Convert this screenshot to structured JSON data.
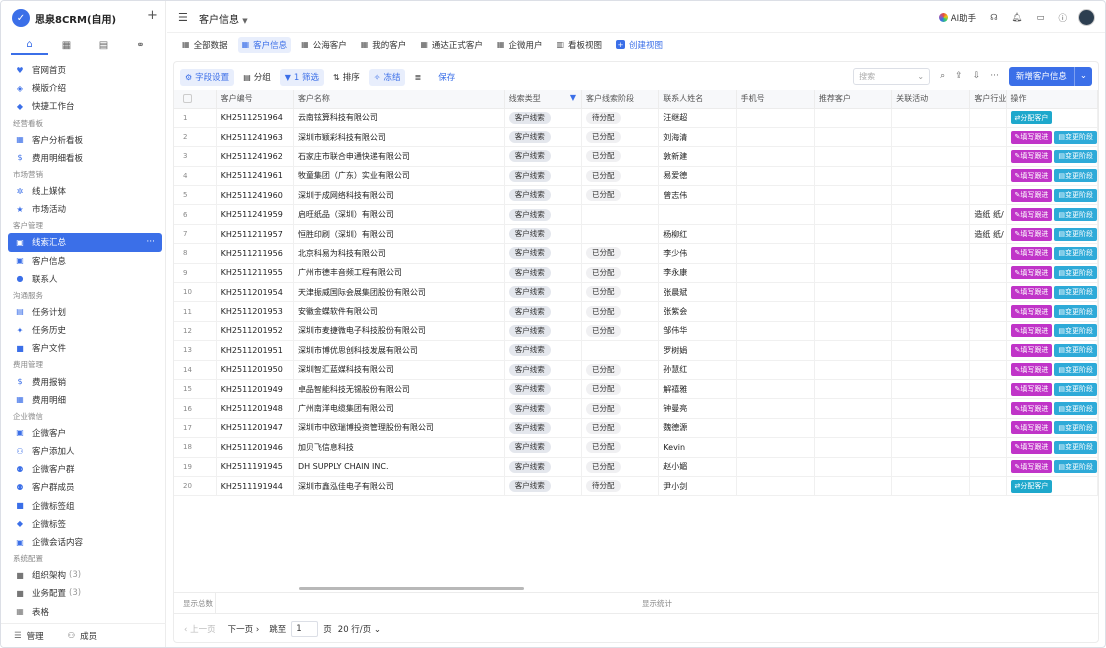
{
  "app": {
    "name": "思泉8CRM(自用)",
    "logo_letter": "✓"
  },
  "sidebar": {
    "tabs": [
      {
        "icon": "home-icon"
      },
      {
        "icon": "grid-icon"
      },
      {
        "icon": "document-icon"
      },
      {
        "icon": "flow-icon"
      }
    ],
    "items": [
      {
        "type": "item",
        "label": "官网首页",
        "icon": "heart-icon",
        "glyph": "♥"
      },
      {
        "type": "item",
        "label": "模版介绍",
        "icon": "palette-icon",
        "glyph": "◈"
      },
      {
        "type": "item",
        "label": "快捷工作台",
        "icon": "diamond-icon",
        "glyph": "◆"
      },
      {
        "type": "group",
        "label": "经营看板"
      },
      {
        "type": "item",
        "label": "客户分析看板",
        "icon": "chart-icon",
        "glyph": "▦"
      },
      {
        "type": "item",
        "label": "费用明细看板",
        "icon": "dollar-circle-icon",
        "glyph": "$"
      },
      {
        "type": "group",
        "label": "市场营销"
      },
      {
        "type": "item",
        "label": "线上媒体",
        "icon": "gear-icon",
        "glyph": "✲"
      },
      {
        "type": "item",
        "label": "市场活动",
        "icon": "star-icon",
        "glyph": "★"
      },
      {
        "type": "group",
        "label": "客户管理"
      },
      {
        "type": "item",
        "label": "线索汇总",
        "icon": "folder-user-icon",
        "glyph": "▣",
        "active": true,
        "more": "···"
      },
      {
        "type": "item",
        "label": "客户信息",
        "icon": "folder-user-icon",
        "glyph": "▣"
      },
      {
        "type": "item",
        "label": "联系人",
        "icon": "user-icon",
        "glyph": "●"
      },
      {
        "type": "group",
        "label": "沟通服务"
      },
      {
        "type": "item",
        "label": "任务计划",
        "icon": "calendar-icon",
        "glyph": "▤"
      },
      {
        "type": "item",
        "label": "任务历史",
        "icon": "run-icon",
        "glyph": "✦"
      },
      {
        "type": "item",
        "label": "客户文件",
        "icon": "folder-icon",
        "glyph": "■"
      },
      {
        "type": "group",
        "label": "费用管理"
      },
      {
        "type": "item",
        "label": "费用报销",
        "icon": "dollar-icon",
        "glyph": "$"
      },
      {
        "type": "item",
        "label": "费用明细",
        "icon": "table-icon",
        "glyph": "▦"
      },
      {
        "type": "group",
        "label": "企业微信"
      },
      {
        "type": "item",
        "label": "企微客户",
        "icon": "folder-user-icon",
        "glyph": "▣"
      },
      {
        "type": "item",
        "label": "客户添加人",
        "icon": "user-add-icon",
        "glyph": "⚇"
      },
      {
        "type": "item",
        "label": "企微客户群",
        "icon": "group-icon",
        "glyph": "⚉"
      },
      {
        "type": "item",
        "label": "客户群成员",
        "icon": "group-icon",
        "glyph": "⚉"
      },
      {
        "type": "item",
        "label": "企微标签组",
        "icon": "folder-icon",
        "glyph": "■"
      },
      {
        "type": "item",
        "label": "企微标签",
        "icon": "tag-icon",
        "glyph": "◆"
      },
      {
        "type": "item",
        "label": "企微会话内容",
        "icon": "folder-chat-icon",
        "glyph": "▣"
      },
      {
        "type": "group",
        "label": "系统配置"
      },
      {
        "type": "item",
        "label": "组织架构",
        "icon": "folder-icon",
        "glyph": "■",
        "count": "(3)",
        "gray": true
      },
      {
        "type": "item",
        "label": "业务配置",
        "icon": "folder-icon",
        "glyph": "■",
        "count": "(3)",
        "gray": true
      },
      {
        "type": "item",
        "label": "表格",
        "icon": "table-icon",
        "glyph": "▦",
        "gray": true
      }
    ],
    "footer": {
      "manage": "管理",
      "members": "成员"
    }
  },
  "header": {
    "title": "客户信息",
    "ai": "AI助手",
    "icons": [
      "headset-icon",
      "bell-icon",
      "inbox-icon",
      "help-icon"
    ]
  },
  "views": [
    {
      "label": "全部数据",
      "icon": "grid-icon",
      "glyph": "▦"
    },
    {
      "label": "客户信息",
      "icon": "grid-icon",
      "glyph": "▦",
      "active": true
    },
    {
      "label": "公海客户",
      "icon": "grid-icon",
      "glyph": "▦"
    },
    {
      "label": "我的客户",
      "icon": "grid-icon",
      "glyph": "▦"
    },
    {
      "label": "通达正式客户",
      "icon": "grid-icon",
      "glyph": "▦"
    },
    {
      "label": "企微用户",
      "icon": "grid-icon",
      "glyph": "▦"
    },
    {
      "label": "看板视图",
      "icon": "kanban-icon",
      "glyph": "▥"
    },
    {
      "label": "创建视图",
      "icon": "plus-icon",
      "glyph": "+",
      "create": true
    }
  ],
  "toolbar": {
    "field_settings": "字段设置",
    "group": "分组",
    "filter": "1 筛选",
    "sort": "排序",
    "freeze": "冻结",
    "row_height": "",
    "save": "保存",
    "search_placeholder": "搜索",
    "new_button": "新增客户信息"
  },
  "table": {
    "columns": [
      "",
      "客户编号",
      "客户名称",
      "线索类型",
      "客户线索阶段",
      "联系人姓名",
      "手机号",
      "推荐客户",
      "关联活动",
      "客户行业",
      "操作"
    ],
    "actions": {
      "follow": "填写跟进",
      "stage": "变更阶段",
      "assign": "分配客户"
    },
    "rows": [
      {
        "no": "1",
        "id": "KH2511251964",
        "name": "云南铉算科技有限公司",
        "type": "客户线索",
        "stage": "待分配",
        "contact": "汪继超",
        "industry": "",
        "mode": "assign"
      },
      {
        "no": "2",
        "id": "KH2511241963",
        "name": "深圳市颖彩科技有限公司",
        "type": "客户线索",
        "stage": "已分配",
        "contact": "刘海清",
        "industry": "",
        "mode": "both"
      },
      {
        "no": "3",
        "id": "KH2511241962",
        "name": "石家庄市联合申通快递有限公司",
        "type": "客户线索",
        "stage": "已分配",
        "contact": "敦新建",
        "industry": "",
        "mode": "both"
      },
      {
        "no": "4",
        "id": "KH2511241961",
        "name": "牧童集团（广东）实业有限公司",
        "type": "客户线索",
        "stage": "已分配",
        "contact": "易爱德",
        "industry": "",
        "mode": "both"
      },
      {
        "no": "5",
        "id": "KH2511241960",
        "name": "深圳于成网络科技有限公司",
        "type": "客户线索",
        "stage": "已分配",
        "contact": "曾志伟",
        "industry": "",
        "mode": "both"
      },
      {
        "no": "6",
        "id": "KH2511241959",
        "name": "启旺纸品（深圳）有限公司",
        "type": "客户线索",
        "stage": "",
        "contact": "",
        "industry": "造纸 纸/",
        "mode": "both"
      },
      {
        "no": "7",
        "id": "KH2511211957",
        "name": "恒胜印刷（深圳）有限公司",
        "type": "客户线索",
        "stage": "",
        "contact": "杨柳红",
        "industry": "造纸 纸/",
        "mode": "both"
      },
      {
        "no": "8",
        "id": "KH2511211956",
        "name": "北京科易为科技有限公司",
        "type": "客户线索",
        "stage": "已分配",
        "contact": "李少伟",
        "industry": "",
        "mode": "both"
      },
      {
        "no": "9",
        "id": "KH2511211955",
        "name": "广州市德丰音频工程有限公司",
        "type": "客户线索",
        "stage": "已分配",
        "contact": "李永康",
        "industry": "",
        "mode": "both"
      },
      {
        "no": "10",
        "id": "KH2511201954",
        "name": "天津振威国际会展集团股份有限公司",
        "type": "客户线索",
        "stage": "已分配",
        "contact": "张晨斌",
        "industry": "",
        "mode": "both"
      },
      {
        "no": "11",
        "id": "KH2511201953",
        "name": "安徽金蝶软件有限公司",
        "type": "客户线索",
        "stage": "已分配",
        "contact": "张紫会",
        "industry": "",
        "mode": "both"
      },
      {
        "no": "12",
        "id": "KH2511201952",
        "name": "深圳市麦捷微电子科技股份有限公司",
        "type": "客户线索",
        "stage": "已分配",
        "contact": "邹伟华",
        "industry": "",
        "mode": "both"
      },
      {
        "no": "13",
        "id": "KH2511201951",
        "name": "深圳市博优思创科技发展有限公司",
        "type": "客户线索",
        "stage": "",
        "contact": "罗树娟",
        "industry": "",
        "mode": "both"
      },
      {
        "no": "14",
        "id": "KH2511201950",
        "name": "深圳智汇蓝媒科技有限公司",
        "type": "客户线索",
        "stage": "已分配",
        "contact": "孙慧红",
        "industry": "",
        "mode": "both"
      },
      {
        "no": "15",
        "id": "KH2511201949",
        "name": "卓品智能科技无锡股份有限公司",
        "type": "客户线索",
        "stage": "已分配",
        "contact": "解禧雅",
        "industry": "",
        "mode": "both"
      },
      {
        "no": "16",
        "id": "KH2511201948",
        "name": "广州南洋电缆集团有限公司",
        "type": "客户线索",
        "stage": "已分配",
        "contact": "钟曼亮",
        "industry": "",
        "mode": "both"
      },
      {
        "no": "17",
        "id": "KH2511201947",
        "name": "深圳市中欧瑞博投资管理股份有限公司",
        "type": "客户线索",
        "stage": "已分配",
        "contact": "魏德源",
        "industry": "",
        "mode": "both"
      },
      {
        "no": "18",
        "id": "KH2511201946",
        "name": "加贝飞信息科技",
        "type": "客户线索",
        "stage": "已分配",
        "contact": "Kevin",
        "industry": "",
        "mode": "both"
      },
      {
        "no": "19",
        "id": "KH2511191945",
        "name": "DH SUPPLY CHAIN INC.",
        "type": "客户线索",
        "stage": "已分配",
        "contact": "赵小媚",
        "industry": "",
        "mode": "both"
      },
      {
        "no": "20",
        "id": "KH2511191944",
        "name": "深圳市鑫泓佳电子有限公司",
        "type": "客户线索",
        "stage": "待分配",
        "contact": "尹小剑",
        "industry": "",
        "mode": "assign"
      }
    ]
  },
  "summary": {
    "left": "显示总数",
    "center": "显示统计"
  },
  "pager": {
    "prev": "上一页",
    "next": "下一页",
    "jump": "跳至",
    "page_value": "1",
    "page_unit": "页",
    "page_size": "20 行/页"
  }
}
